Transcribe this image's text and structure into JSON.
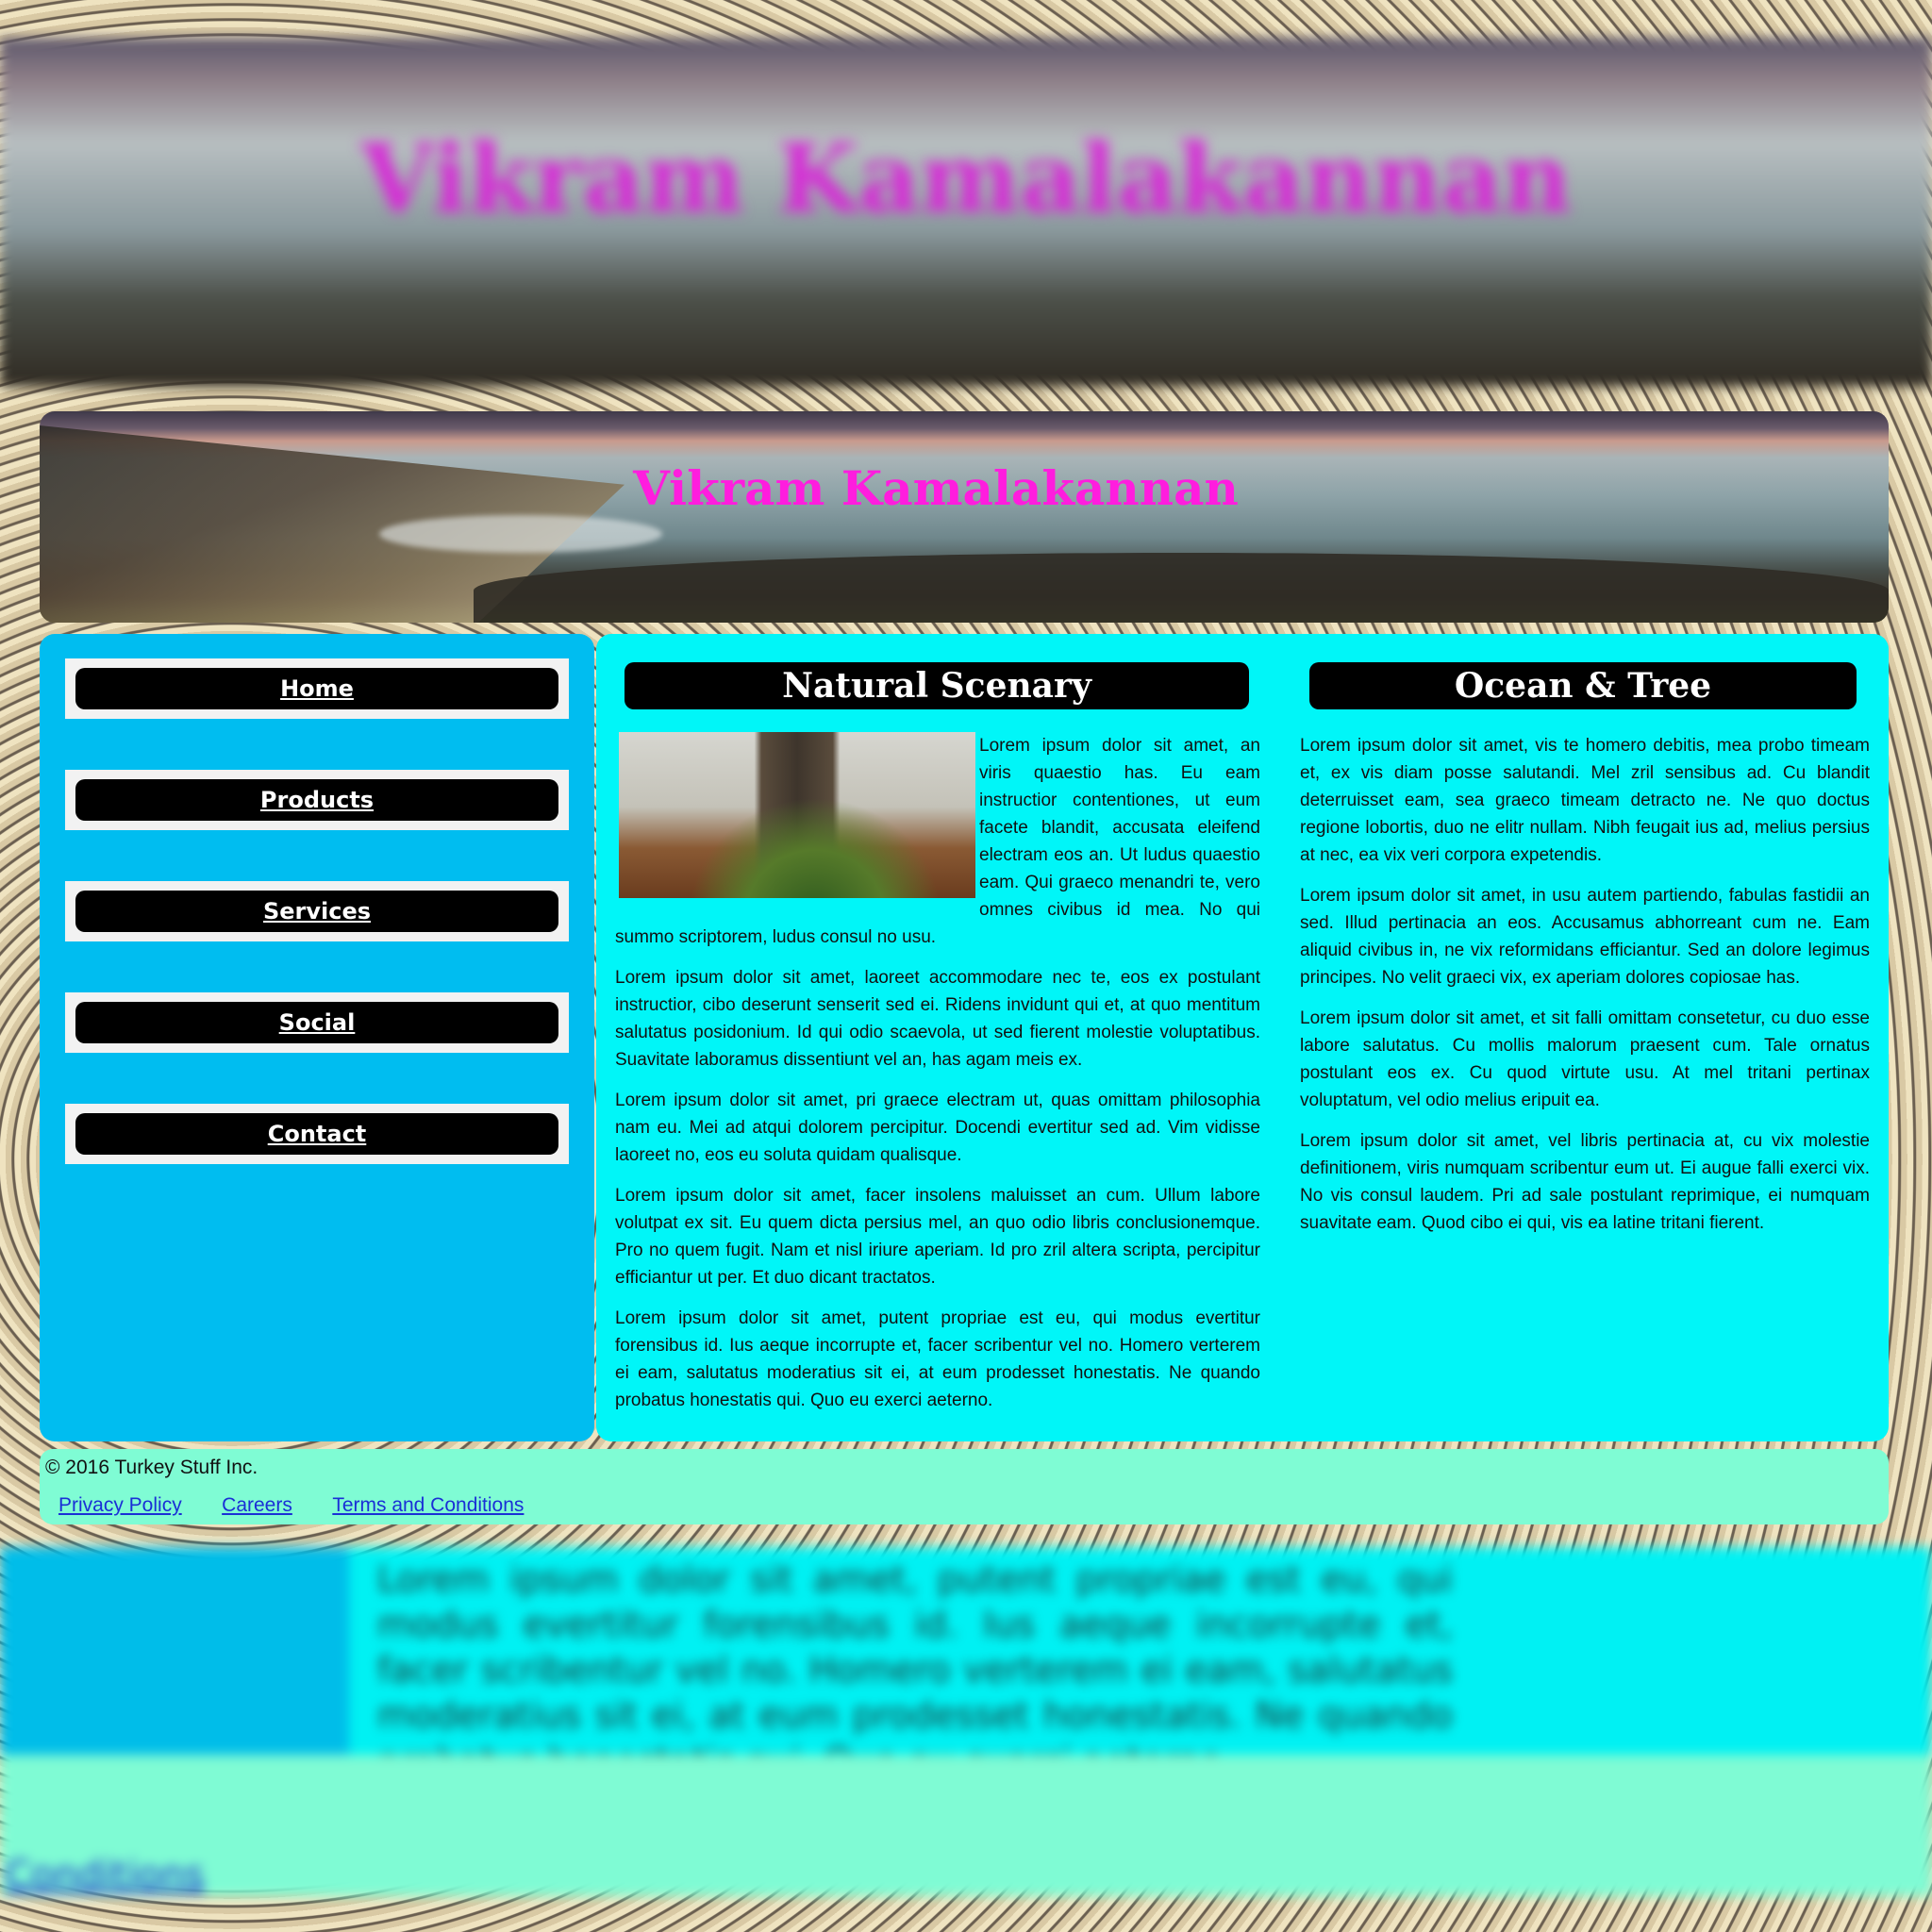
{
  "site_title": "Vikram Kamalakannan",
  "nav": {
    "home": "Home",
    "products": "Products",
    "services": "Services",
    "social": "Social",
    "contact": "Contact"
  },
  "column1": {
    "title": "Natural Scenary",
    "p1": "Lorem ipsum dolor sit amet, an viris quaestio has. Eu eam instructior contentiones, ut eum facete blandit, accusata eleifend electram eos an. Ut ludus quaestio eam. Qui graeco menandri te, vero omnes civibus id mea. No qui summo scriptorem, ludus consul no usu.",
    "p2": "Lorem ipsum dolor sit amet, laoreet accommodare nec te, eos ex postulant instructior, cibo deserunt senserit sed ei. Ridens invidunt qui et, at quo mentitum salutatus posidonium. Id qui odio scaevola, ut sed fierent molestie voluptatibus. Suavitate laboramus dissentiunt vel an, has agam meis ex.",
    "p3": "Lorem ipsum dolor sit amet, pri graece electram ut, quas omittam philosophia nam eu. Mei ad atqui dolorem percipitur. Docendi evertitur sed ad. Vim vidisse laoreet no, eos eu soluta quidam qualisque.",
    "p4": "Lorem ipsum dolor sit amet, facer insolens maluisset an cum. Ullum labore volutpat ex sit. Eu quem dicta persius mel, an quo odio libris conclusionemque. Pro no quem fugit. Nam et nisl iriure aperiam. Id pro zril altera scripta, percipitur efficiantur ut per. Et duo dicant tractatos.",
    "p5": "Lorem ipsum dolor sit amet, putent propriae est eu, qui modus evertitur forensibus id. Ius aeque incorrupte et, facer scribentur vel no. Homero verterem ei eam, salutatus moderatius sit ei, at eum prodesset honestatis. Ne quando probatus honestatis qui. Quo eu exerci aeterno."
  },
  "column2": {
    "title": "Ocean & Tree",
    "p1": "Lorem ipsum dolor sit amet, vis te homero debitis, mea probo timeam et, ex vis diam posse salutandi. Mel zril sensibus ad. Cu blandit deterruisset eam, sea graeco timeam detracto ne. Ne quo doctus regione lobortis, duo ne elitr nullam. Nibh feugait ius ad, melius persius at nec, ea vix veri corpora expetendis.",
    "p2": "Lorem ipsum dolor sit amet, in usu autem partiendo, fabulas fastidii an sed. Illud pertinacia an eos. Accusamus abhorreant cum ne. Eam aliquid civibus in, ne vix reformidans efficiantur. Sed an dolore legimus principes. No velit graeci vix, ex aperiam dolores copiosae has.",
    "p3": "Lorem ipsum dolor sit amet, et sit falli omittam consetetur, cu duo esse labore salutatus. Cu mollis malorum praesent cum. Tale ornatus postulant eos ex. Cu quod virtute usu. At mel tritani pertinax voluptatum, vel odio melius eripuit ea.",
    "p4": "Lorem ipsum dolor sit amet, vel libris pertinacia at, cu vix molestie definitionem, viris numquam scribentur eum ut. Ei augue falli exerci vix. No vis consul laudem. Pri ad sale postulant reprimique, ei numquam suavitate eam. Quod cibo ei qui, vis ea latine tritani fierent."
  },
  "footer": {
    "copyright": "© 2016 Turkey Stuff Inc.",
    "links": [
      "Privacy Policy",
      "Careers",
      "Terms and Conditions"
    ]
  },
  "backdrop": {
    "bottom_text": "Lorem ipsum dolor sit amet, putent propriae est eu, qui modus evertitur forensibus id. Ius aeque incorrupte et, facer scribentur vel no. Homero verterem ei eam, salutatus moderatius sit ei, at eum prodesset honestatis. Ne quando probatus honestatis qui. Quo eu exerci aeterno.",
    "bottom_link": "Conditions"
  },
  "colors": {
    "title": "#ff1dde",
    "sidebar": "#00bdf0",
    "content": "#00f6f8",
    "footer": "#7ffcd4",
    "nav_button": "#000000",
    "link": "#1a2fd6"
  }
}
